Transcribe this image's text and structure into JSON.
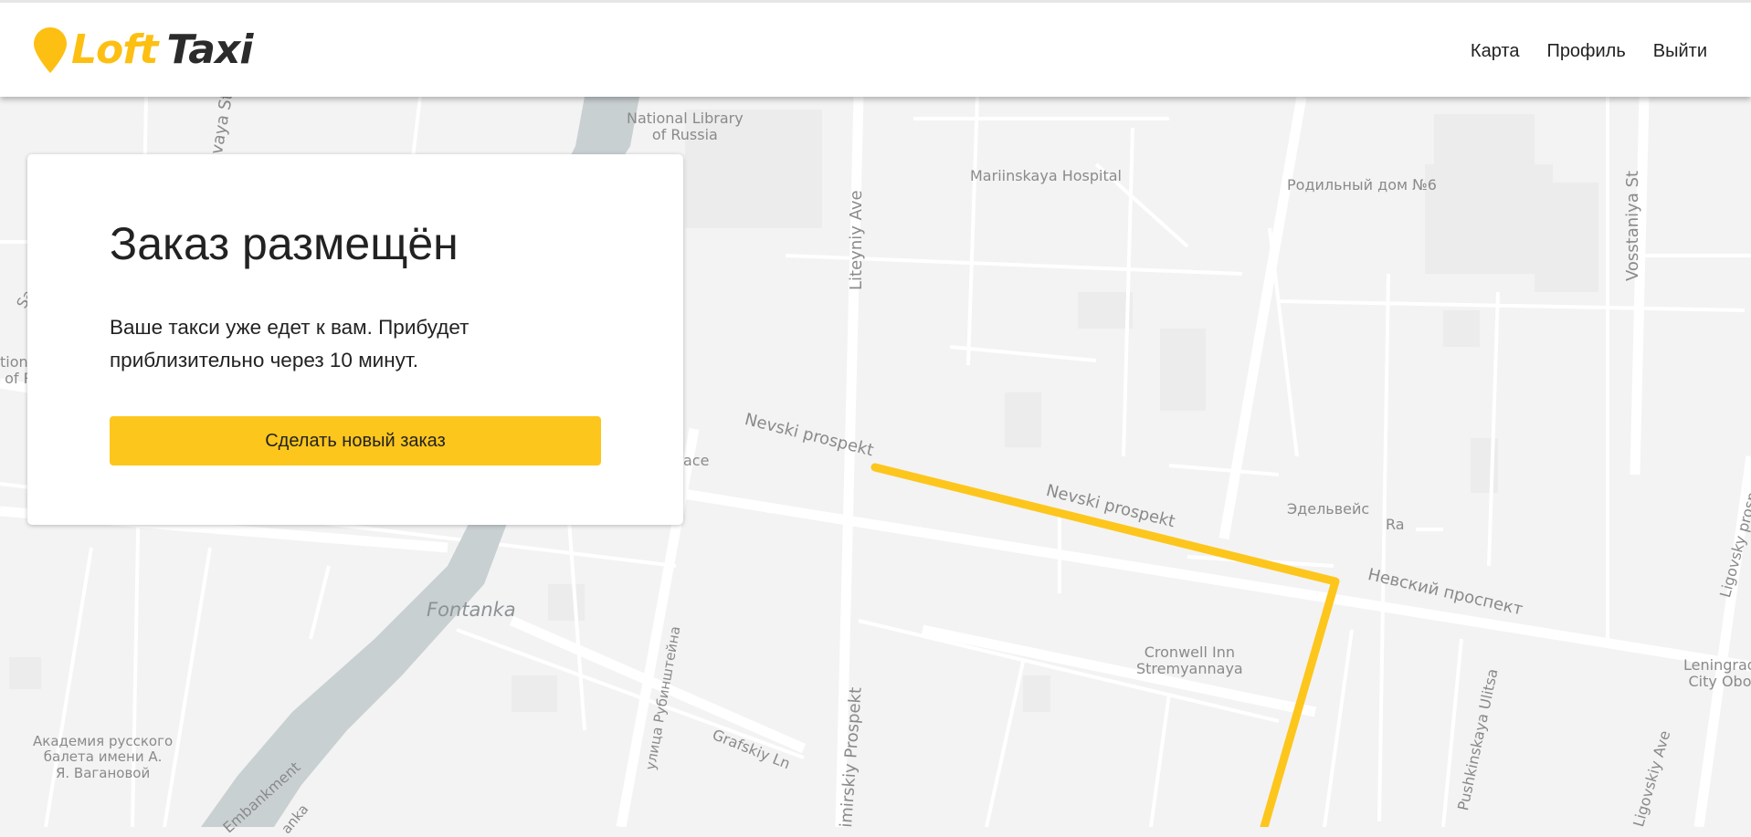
{
  "app": {
    "logo_word1": "Loft",
    "logo_word2": "Taxi"
  },
  "nav": {
    "items": [
      {
        "label": "Карта"
      },
      {
        "label": "Профиль"
      },
      {
        "label": "Выйти"
      }
    ]
  },
  "order_card": {
    "title": "Заказ размещён",
    "message": "Ваше такси уже едет к вам. Прибудет приблизительно через 10 минут.",
    "button_label": "Сделать новый заказ"
  },
  "map": {
    "labels": {
      "national_library": "National Library\nof Russia",
      "mariinskaya": "Mariinskaya Hospital",
      "rodilny": "Родильный дом №6",
      "vosstaniya": "Vosstaniya St",
      "liteyniy": "Liteyniy Ave",
      "zhukovskaya": "ovaya St",
      "nevski1": "Nevski prospekt",
      "nevski2": "Nevski prospekt",
      "nevsky_ru": "Невский проспект",
      "edelweiss": "Эдельвейс",
      "ra": "Ra",
      "fontanka": "Fontanka",
      "cronwell": "Cronwell Inn\nStremyannaya",
      "rubinshteina": "улица Рубинштейна",
      "grafskiy": "Grafskiy Ln",
      "vladimirskiy": "imirskiy Prospekt",
      "pushkinskaya": "Pushkinskaya Ulitsa",
      "ligovsky_ave": "Ligovskiy Ave",
      "ligovsky_pr": "Ligovsky prosp",
      "leningrad": "Leningrad\nCity Obo",
      "academy": "Академия русского\nбалета имени А.\nЯ. Вагановой",
      "embankment": "Embankment",
      "anka": "anka",
      "place": "ace",
      "sad": "Sad",
      "natl_edge": "tiona\n of R"
    },
    "route_color": "#fdc61d",
    "water_color": "#c9d0d2"
  },
  "colors": {
    "accent": "#fdc61d",
    "logo_yellow": "#fdbf12",
    "logo_dark": "#2b2b2b"
  }
}
